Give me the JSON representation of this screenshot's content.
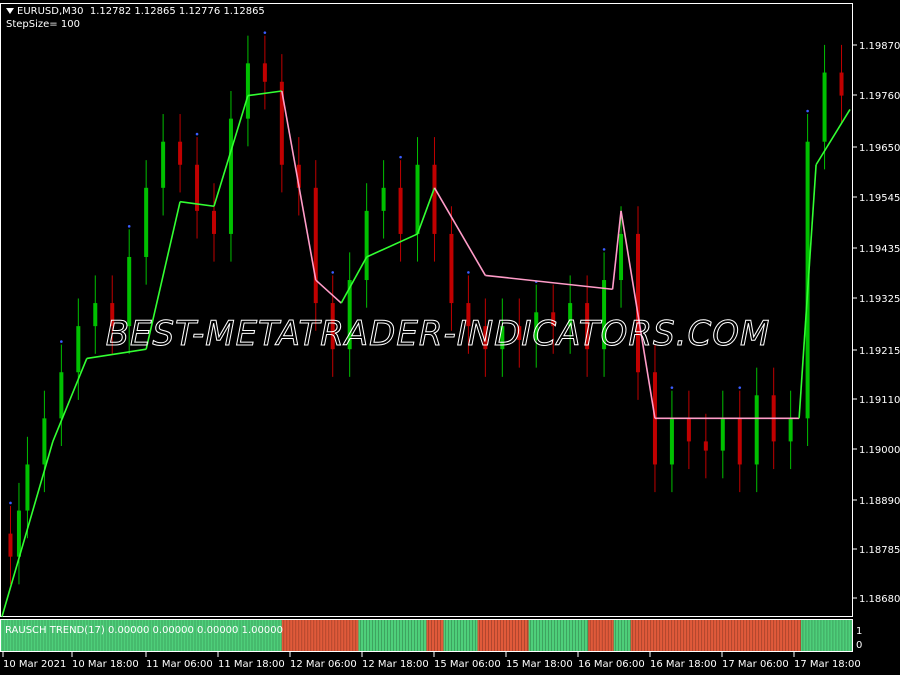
{
  "header": {
    "symbol": "EURUSD,M30",
    "prices": "1.12782 1.12865 1.12776 1.12865",
    "step_size": "StepSize= 100"
  },
  "indicator": {
    "label": "RAUSCH TREND(17) 0.00000 0.00000 0.00000 1.00000",
    "scale_top": "1",
    "scale_bottom": "0"
  },
  "watermark": "BEST-METATRADER-INDICATORS.COM",
  "colors": {
    "background": "#000000",
    "bull_candle": "#00c000",
    "bear_candle": "#c00000",
    "trend_up": "#32ff32",
    "trend_down": "#ff9cc8",
    "fractal": "#3a5cff",
    "indicator_up": "#4ecf7a",
    "indicator_down": "#e05a3a"
  },
  "chart_data": {
    "type": "line",
    "symbol": "EURUSD,M30",
    "price_ticks": [
      "1.19870",
      "1.19760",
      "1.19650",
      "1.19545",
      "1.19435",
      "1.19325",
      "1.19215",
      "1.19110",
      "1.19000",
      "1.18890",
      "1.18785",
      "1.18680"
    ],
    "time_ticks": [
      "10 Mar 2021",
      "10 Mar 18:00",
      "11 Mar 06:00",
      "11 Mar 18:00",
      "12 Mar 06:00",
      "12 Mar 18:00",
      "15 Mar 06:00",
      "15 Mar 18:00",
      "16 Mar 06:00",
      "16 Mar 18:00",
      "17 Mar 06:00",
      "17 Mar 18:00"
    ],
    "ylim": [
      1.1863,
      1.1994
    ],
    "trend_line": [
      {
        "t": 0.0,
        "v": 1.1862,
        "dir": "up"
      },
      {
        "t": 0.06,
        "v": 1.19,
        "dir": "up"
      },
      {
        "t": 0.1,
        "v": 1.1918,
        "dir": "up"
      },
      {
        "t": 0.17,
        "v": 1.192,
        "dir": "up"
      },
      {
        "t": 0.21,
        "v": 1.1952,
        "dir": "up"
      },
      {
        "t": 0.25,
        "v": 1.1951,
        "dir": "up"
      },
      {
        "t": 0.29,
        "v": 1.1975,
        "dir": "up"
      },
      {
        "t": 0.33,
        "v": 1.1976,
        "dir": "down"
      },
      {
        "t": 0.37,
        "v": 1.1935,
        "dir": "down"
      },
      {
        "t": 0.4,
        "v": 1.193,
        "dir": "up"
      },
      {
        "t": 0.43,
        "v": 1.194,
        "dir": "up"
      },
      {
        "t": 0.49,
        "v": 1.1945,
        "dir": "up"
      },
      {
        "t": 0.51,
        "v": 1.1955,
        "dir": "down"
      },
      {
        "t": 0.57,
        "v": 1.1936,
        "dir": "down"
      },
      {
        "t": 0.72,
        "v": 1.1933,
        "dir": "down"
      },
      {
        "t": 0.73,
        "v": 1.195,
        "dir": "down"
      },
      {
        "t": 0.77,
        "v": 1.1905,
        "dir": "down"
      },
      {
        "t": 0.94,
        "v": 1.1905,
        "dir": "up"
      },
      {
        "t": 0.96,
        "v": 1.196,
        "dir": "up"
      },
      {
        "t": 1.0,
        "v": 1.1972,
        "dir": "up"
      }
    ],
    "candles": [
      {
        "t": 0.01,
        "o": 1.188,
        "c": 1.1875
      },
      {
        "t": 0.02,
        "o": 1.1875,
        "c": 1.1885
      },
      {
        "t": 0.03,
        "o": 1.1885,
        "c": 1.1895
      },
      {
        "t": 0.05,
        "o": 1.1895,
        "c": 1.1905
      },
      {
        "t": 0.07,
        "o": 1.1905,
        "c": 1.1915
      },
      {
        "t": 0.09,
        "o": 1.1915,
        "c": 1.1925
      },
      {
        "t": 0.11,
        "o": 1.1925,
        "c": 1.193
      },
      {
        "t": 0.13,
        "o": 1.193,
        "c": 1.1925
      },
      {
        "t": 0.15,
        "o": 1.1925,
        "c": 1.194
      },
      {
        "t": 0.17,
        "o": 1.194,
        "c": 1.1955
      },
      {
        "t": 0.19,
        "o": 1.1955,
        "c": 1.1965
      },
      {
        "t": 0.21,
        "o": 1.1965,
        "c": 1.196
      },
      {
        "t": 0.23,
        "o": 1.196,
        "c": 1.195
      },
      {
        "t": 0.25,
        "o": 1.195,
        "c": 1.1945
      },
      {
        "t": 0.27,
        "o": 1.1945,
        "c": 1.197
      },
      {
        "t": 0.29,
        "o": 1.197,
        "c": 1.1982
      },
      {
        "t": 0.31,
        "o": 1.1982,
        "c": 1.1978
      },
      {
        "t": 0.33,
        "o": 1.1978,
        "c": 1.196
      },
      {
        "t": 0.35,
        "o": 1.196,
        "c": 1.1955
      },
      {
        "t": 0.37,
        "o": 1.1955,
        "c": 1.193
      },
      {
        "t": 0.39,
        "o": 1.193,
        "c": 1.192
      },
      {
        "t": 0.41,
        "o": 1.192,
        "c": 1.1935
      },
      {
        "t": 0.43,
        "o": 1.1935,
        "c": 1.195
      },
      {
        "t": 0.45,
        "o": 1.195,
        "c": 1.1955
      },
      {
        "t": 0.47,
        "o": 1.1955,
        "c": 1.1945
      },
      {
        "t": 0.49,
        "o": 1.1945,
        "c": 1.196
      },
      {
        "t": 0.51,
        "o": 1.196,
        "c": 1.1945
      },
      {
        "t": 0.53,
        "o": 1.1945,
        "c": 1.193
      },
      {
        "t": 0.55,
        "o": 1.193,
        "c": 1.1925
      },
      {
        "t": 0.57,
        "o": 1.1925,
        "c": 1.192
      },
      {
        "t": 0.59,
        "o": 1.192,
        "c": 1.1925
      },
      {
        "t": 0.61,
        "o": 1.1925,
        "c": 1.1922
      },
      {
        "t": 0.63,
        "o": 1.1922,
        "c": 1.1928
      },
      {
        "t": 0.65,
        "o": 1.1928,
        "c": 1.1925
      },
      {
        "t": 0.67,
        "o": 1.1925,
        "c": 1.193
      },
      {
        "t": 0.69,
        "o": 1.193,
        "c": 1.192
      },
      {
        "t": 0.71,
        "o": 1.192,
        "c": 1.1935
      },
      {
        "t": 0.73,
        "o": 1.1935,
        "c": 1.1945
      },
      {
        "t": 0.75,
        "o": 1.1945,
        "c": 1.1915
      },
      {
        "t": 0.77,
        "o": 1.1915,
        "c": 1.1895
      },
      {
        "t": 0.79,
        "o": 1.1895,
        "c": 1.1905
      },
      {
        "t": 0.81,
        "o": 1.1905,
        "c": 1.19
      },
      {
        "t": 0.83,
        "o": 1.19,
        "c": 1.1898
      },
      {
        "t": 0.85,
        "o": 1.1898,
        "c": 1.1905
      },
      {
        "t": 0.87,
        "o": 1.1905,
        "c": 1.1895
      },
      {
        "t": 0.89,
        "o": 1.1895,
        "c": 1.191
      },
      {
        "t": 0.91,
        "o": 1.191,
        "c": 1.19
      },
      {
        "t": 0.93,
        "o": 1.19,
        "c": 1.1905
      },
      {
        "t": 0.95,
        "o": 1.1905,
        "c": 1.1965
      },
      {
        "t": 0.97,
        "o": 1.1965,
        "c": 1.198
      },
      {
        "t": 0.99,
        "o": 1.198,
        "c": 1.1975
      }
    ],
    "indicator_blocks": [
      {
        "t0": 0.0,
        "t1": 0.33,
        "dir": "up"
      },
      {
        "t0": 0.33,
        "t1": 0.42,
        "dir": "down"
      },
      {
        "t0": 0.42,
        "t1": 0.5,
        "dir": "up"
      },
      {
        "t0": 0.5,
        "t1": 0.52,
        "dir": "down"
      },
      {
        "t0": 0.52,
        "t1": 0.56,
        "dir": "up"
      },
      {
        "t0": 0.56,
        "t1": 0.62,
        "dir": "down"
      },
      {
        "t0": 0.62,
        "t1": 0.69,
        "dir": "up"
      },
      {
        "t0": 0.69,
        "t1": 0.72,
        "dir": "down"
      },
      {
        "t0": 0.72,
        "t1": 0.74,
        "dir": "up"
      },
      {
        "t0": 0.74,
        "t1": 0.94,
        "dir": "down"
      },
      {
        "t0": 0.94,
        "t1": 1.0,
        "dir": "up"
      }
    ]
  }
}
